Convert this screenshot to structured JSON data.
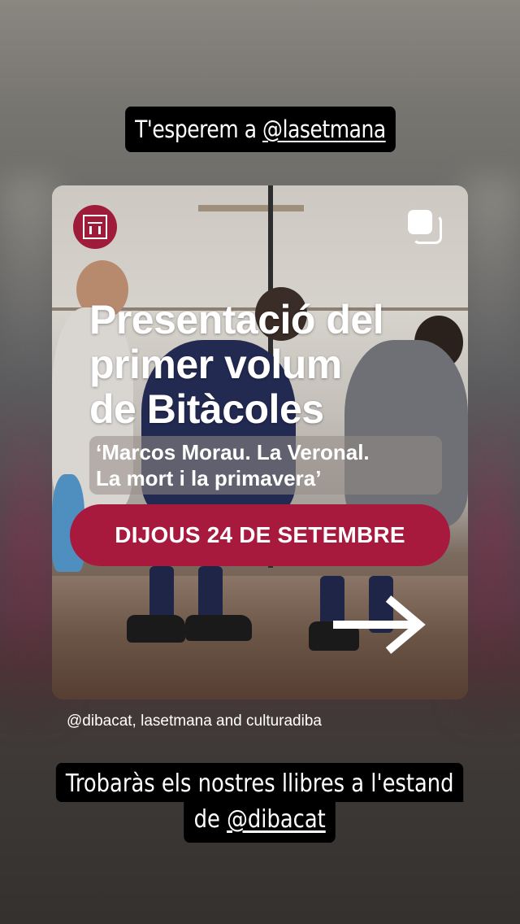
{
  "story": {
    "top_caption": {
      "prefix": "T'esperem a ",
      "mention": "@lasetmana"
    },
    "bottom_caption": {
      "line1": "Trobaràs els nostres llibres a l'estand",
      "line2_prefix": "de ",
      "line2_mention": "@dibacat"
    },
    "mentions": "@dibacat, lasetmana and culturadiba"
  },
  "post": {
    "headline": [
      "Presentació del",
      "primer volum",
      "de Bitàcoles"
    ],
    "subtitle": [
      "‘Marcos Morau. La Veronal.",
      "La mort i la primavera’"
    ],
    "date": "DIJOUS 24 DE SETEMBRE",
    "icons": {
      "logo": "diba-crest-icon",
      "multi": "multiple-images-icon",
      "arrow": "arrow-right-icon"
    },
    "colors": {
      "accent": "#a8193e",
      "logo_bg": "#9e1b39"
    }
  }
}
